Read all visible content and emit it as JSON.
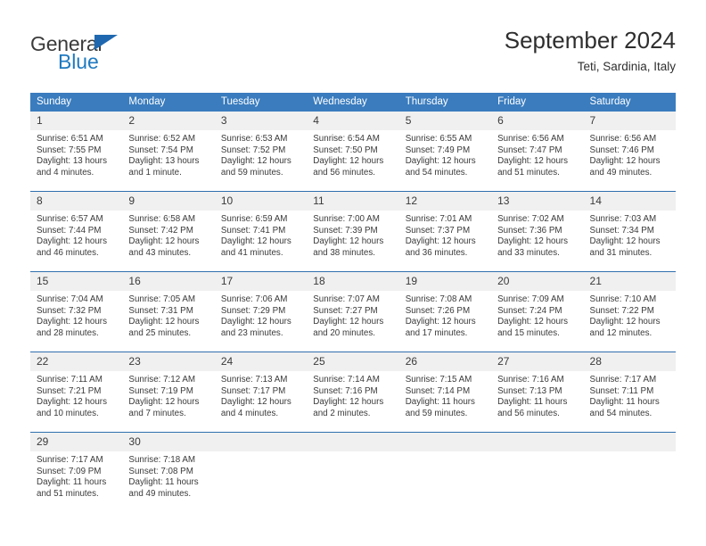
{
  "brand": {
    "name_part1": "General",
    "name_part2": "Blue",
    "accent_color": "#1f7ac0",
    "triangle_color": "#1f68b0"
  },
  "header": {
    "title": "September 2024",
    "location": "Teti, Sardinia, Italy"
  },
  "calendar": {
    "header_bg": "#3a7cbe",
    "daynum_bg": "#f0f0f0",
    "week_separator_color": "#2f6fae",
    "weekdays": [
      "Sunday",
      "Monday",
      "Tuesday",
      "Wednesday",
      "Thursday",
      "Friday",
      "Saturday"
    ],
    "weeks": [
      [
        {
          "day": "1",
          "sunrise": "Sunrise: 6:51 AM",
          "sunset": "Sunset: 7:55 PM",
          "daylight": "Daylight: 13 hours and 4 minutes."
        },
        {
          "day": "2",
          "sunrise": "Sunrise: 6:52 AM",
          "sunset": "Sunset: 7:54 PM",
          "daylight": "Daylight: 13 hours and 1 minute."
        },
        {
          "day": "3",
          "sunrise": "Sunrise: 6:53 AM",
          "sunset": "Sunset: 7:52 PM",
          "daylight": "Daylight: 12 hours and 59 minutes."
        },
        {
          "day": "4",
          "sunrise": "Sunrise: 6:54 AM",
          "sunset": "Sunset: 7:50 PM",
          "daylight": "Daylight: 12 hours and 56 minutes."
        },
        {
          "day": "5",
          "sunrise": "Sunrise: 6:55 AM",
          "sunset": "Sunset: 7:49 PM",
          "daylight": "Daylight: 12 hours and 54 minutes."
        },
        {
          "day": "6",
          "sunrise": "Sunrise: 6:56 AM",
          "sunset": "Sunset: 7:47 PM",
          "daylight": "Daylight: 12 hours and 51 minutes."
        },
        {
          "day": "7",
          "sunrise": "Sunrise: 6:56 AM",
          "sunset": "Sunset: 7:46 PM",
          "daylight": "Daylight: 12 hours and 49 minutes."
        }
      ],
      [
        {
          "day": "8",
          "sunrise": "Sunrise: 6:57 AM",
          "sunset": "Sunset: 7:44 PM",
          "daylight": "Daylight: 12 hours and 46 minutes."
        },
        {
          "day": "9",
          "sunrise": "Sunrise: 6:58 AM",
          "sunset": "Sunset: 7:42 PM",
          "daylight": "Daylight: 12 hours and 43 minutes."
        },
        {
          "day": "10",
          "sunrise": "Sunrise: 6:59 AM",
          "sunset": "Sunset: 7:41 PM",
          "daylight": "Daylight: 12 hours and 41 minutes."
        },
        {
          "day": "11",
          "sunrise": "Sunrise: 7:00 AM",
          "sunset": "Sunset: 7:39 PM",
          "daylight": "Daylight: 12 hours and 38 minutes."
        },
        {
          "day": "12",
          "sunrise": "Sunrise: 7:01 AM",
          "sunset": "Sunset: 7:37 PM",
          "daylight": "Daylight: 12 hours and 36 minutes."
        },
        {
          "day": "13",
          "sunrise": "Sunrise: 7:02 AM",
          "sunset": "Sunset: 7:36 PM",
          "daylight": "Daylight: 12 hours and 33 minutes."
        },
        {
          "day": "14",
          "sunrise": "Sunrise: 7:03 AM",
          "sunset": "Sunset: 7:34 PM",
          "daylight": "Daylight: 12 hours and 31 minutes."
        }
      ],
      [
        {
          "day": "15",
          "sunrise": "Sunrise: 7:04 AM",
          "sunset": "Sunset: 7:32 PM",
          "daylight": "Daylight: 12 hours and 28 minutes."
        },
        {
          "day": "16",
          "sunrise": "Sunrise: 7:05 AM",
          "sunset": "Sunset: 7:31 PM",
          "daylight": "Daylight: 12 hours and 25 minutes."
        },
        {
          "day": "17",
          "sunrise": "Sunrise: 7:06 AM",
          "sunset": "Sunset: 7:29 PM",
          "daylight": "Daylight: 12 hours and 23 minutes."
        },
        {
          "day": "18",
          "sunrise": "Sunrise: 7:07 AM",
          "sunset": "Sunset: 7:27 PM",
          "daylight": "Daylight: 12 hours and 20 minutes."
        },
        {
          "day": "19",
          "sunrise": "Sunrise: 7:08 AM",
          "sunset": "Sunset: 7:26 PM",
          "daylight": "Daylight: 12 hours and 17 minutes."
        },
        {
          "day": "20",
          "sunrise": "Sunrise: 7:09 AM",
          "sunset": "Sunset: 7:24 PM",
          "daylight": "Daylight: 12 hours and 15 minutes."
        },
        {
          "day": "21",
          "sunrise": "Sunrise: 7:10 AM",
          "sunset": "Sunset: 7:22 PM",
          "daylight": "Daylight: 12 hours and 12 minutes."
        }
      ],
      [
        {
          "day": "22",
          "sunrise": "Sunrise: 7:11 AM",
          "sunset": "Sunset: 7:21 PM",
          "daylight": "Daylight: 12 hours and 10 minutes."
        },
        {
          "day": "23",
          "sunrise": "Sunrise: 7:12 AM",
          "sunset": "Sunset: 7:19 PM",
          "daylight": "Daylight: 12 hours and 7 minutes."
        },
        {
          "day": "24",
          "sunrise": "Sunrise: 7:13 AM",
          "sunset": "Sunset: 7:17 PM",
          "daylight": "Daylight: 12 hours and 4 minutes."
        },
        {
          "day": "25",
          "sunrise": "Sunrise: 7:14 AM",
          "sunset": "Sunset: 7:16 PM",
          "daylight": "Daylight: 12 hours and 2 minutes."
        },
        {
          "day": "26",
          "sunrise": "Sunrise: 7:15 AM",
          "sunset": "Sunset: 7:14 PM",
          "daylight": "Daylight: 11 hours and 59 minutes."
        },
        {
          "day": "27",
          "sunrise": "Sunrise: 7:16 AM",
          "sunset": "Sunset: 7:13 PM",
          "daylight": "Daylight: 11 hours and 56 minutes."
        },
        {
          "day": "28",
          "sunrise": "Sunrise: 7:17 AM",
          "sunset": "Sunset: 7:11 PM",
          "daylight": "Daylight: 11 hours and 54 minutes."
        }
      ],
      [
        {
          "day": "29",
          "sunrise": "Sunrise: 7:17 AM",
          "sunset": "Sunset: 7:09 PM",
          "daylight": "Daylight: 11 hours and 51 minutes."
        },
        {
          "day": "30",
          "sunrise": "Sunrise: 7:18 AM",
          "sunset": "Sunset: 7:08 PM",
          "daylight": "Daylight: 11 hours and 49 minutes."
        },
        {
          "day": "",
          "sunrise": "",
          "sunset": "",
          "daylight": ""
        },
        {
          "day": "",
          "sunrise": "",
          "sunset": "",
          "daylight": ""
        },
        {
          "day": "",
          "sunrise": "",
          "sunset": "",
          "daylight": ""
        },
        {
          "day": "",
          "sunrise": "",
          "sunset": "",
          "daylight": ""
        },
        {
          "day": "",
          "sunrise": "",
          "sunset": "",
          "daylight": ""
        }
      ]
    ]
  }
}
